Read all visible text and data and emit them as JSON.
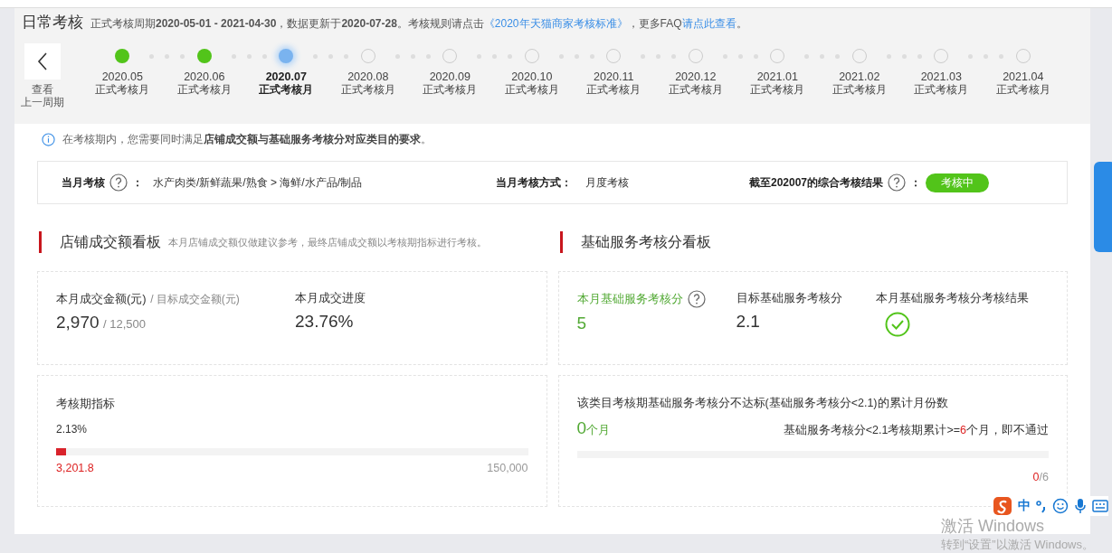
{
  "header": {
    "title": "日常考核",
    "subtitle": "正式考核周期**2020-05-01 - 2021-04-30**，数据更新于**2020-07-28**。考核规则请点击",
    "rules_link": "《2020年天猫商家考核标准》",
    "faq_prefix": "，更多FAQ",
    "faq_link": "请点此查看",
    "faq_suffix": "。"
  },
  "timeline": {
    "back_label_lines": [
      "查看",
      "上一周期"
    ],
    "months": [
      {
        "date": "2020.05",
        "label": "正式考核月",
        "kind": "done",
        "selected": false
      },
      {
        "date": "2020.06",
        "label": "正式考核月",
        "kind": "done",
        "selected": false
      },
      {
        "date": "2020.07",
        "label": "正式考核月",
        "kind": "current",
        "selected": true
      },
      {
        "date": "2020.08",
        "label": "正式考核月",
        "kind": "future",
        "selected": false
      },
      {
        "date": "2020.09",
        "label": "正式考核月",
        "kind": "future",
        "selected": false
      },
      {
        "date": "2020.10",
        "label": "正式考核月",
        "kind": "future",
        "selected": false
      },
      {
        "date": "2020.11",
        "label": "正式考核月",
        "kind": "future",
        "selected": false
      },
      {
        "date": "2020.12",
        "label": "正式考核月",
        "kind": "future",
        "selected": false
      },
      {
        "date": "2021.01",
        "label": "正式考核月",
        "kind": "future",
        "selected": false
      },
      {
        "date": "2021.02",
        "label": "正式考核月",
        "kind": "future",
        "selected": false
      },
      {
        "date": "2021.03",
        "label": "正式考核月",
        "kind": "future",
        "selected": false
      },
      {
        "date": "2021.04",
        "label": "正式考核月",
        "kind": "future",
        "selected": false
      }
    ]
  },
  "notice": "在考核期内，您需要同时满足**店铺成交额与基础服务考核分对应类目的要求**。",
  "assessment": {
    "category_label": "当月考核",
    "colon": "：",
    "category": "水产肉类/新鲜蔬果/熟食 > 海鲜/水产品/制品",
    "method_label": "当月考核方式：",
    "method": "月度考核",
    "result_label": "截至202007的综合考核结果",
    "result_colon": "：",
    "result_badge": "考核中"
  },
  "sales_board": {
    "title": "店铺成交额看板",
    "note": "本月店铺成交额仅做建议参考，最终店铺成交额以考核期指标进行考核。",
    "amount_label": "本月成交金额(元)",
    "target_label": "/ 目标成交金额(元)",
    "amount": "2,970",
    "target": "/ 12,500",
    "progress_label": "本月成交进度",
    "progress": "23.76%",
    "period_label": "考核期指标",
    "period_percent": "2.13%",
    "level": 0.0213,
    "period_value": "3,201.8",
    "period_target": "150,000"
  },
  "service_board": {
    "title": "基础服务考核分看板",
    "score_label": "本月基础服务考核分",
    "score": "5",
    "target_label": "目标基础服务考核分",
    "target": "2.1",
    "result_label": "本月基础服务考核分考核结果",
    "passed": true,
    "fail_label": "该类目考核期基础服务考核分不达标(基础服务考核分<2.1)的累计月份数",
    "fail_count": "0",
    "fail_unit": "个月",
    "rule_before": "基础服务考核分<2.1考核期累计>=",
    "rule_number": "6",
    "rule_after": "个月，即不通过",
    "level": 0,
    "count": "0",
    "total": "/6"
  },
  "os_overlay": {
    "ime_label": "中",
    "activation_title": "激活 Windows",
    "activation_text": "转到“设置”以激活 Windows。"
  }
}
